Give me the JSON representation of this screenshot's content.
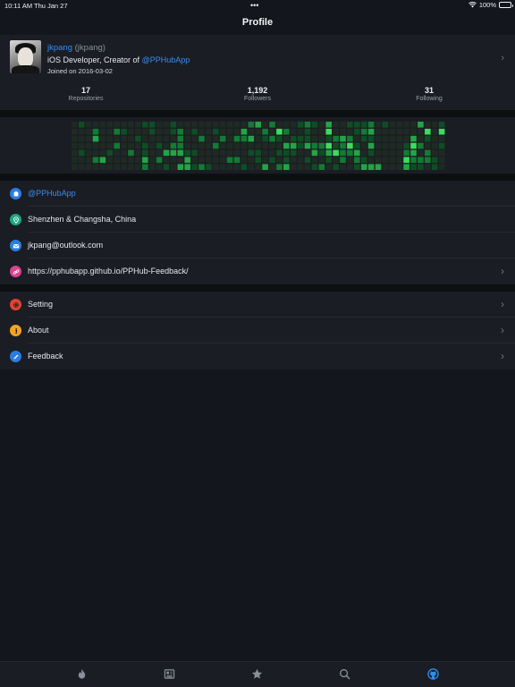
{
  "status_bar": {
    "time": "10:11 AM",
    "date": "Thu Jan 27",
    "dots": "•••",
    "battery": "100%"
  },
  "nav": {
    "title": "Profile"
  },
  "profile": {
    "login": "jkpang",
    "handle": "(jkpang)",
    "bio_prefix": "iOS Developer, Creator of ",
    "bio_link": "@PPHubApp",
    "joined": "Joined on 2016-03-02"
  },
  "stats": [
    {
      "value": "17",
      "label": "Repositories"
    },
    {
      "value": "1,192",
      "label": "Followers"
    },
    {
      "value": "31",
      "label": "Following"
    }
  ],
  "info_rows": [
    {
      "icon": "company-icon",
      "text": "@PPHubApp",
      "color": "#2a7de1"
    },
    {
      "icon": "location-icon",
      "text": "Shenzhen & Changsha, China",
      "color": "#1ba784"
    },
    {
      "icon": "email-icon",
      "text": "jkpang@outlook.com",
      "color": "#2a7de1"
    },
    {
      "icon": "link-icon",
      "text": "https://pphubapp.github.io/PPHub-Feedback/",
      "color": "#d8458d"
    }
  ],
  "menu_rows": [
    {
      "icon": "gear-icon",
      "text": "Setting",
      "color": "#e0442f"
    },
    {
      "icon": "info-icon",
      "text": "About",
      "color": "#f2a320"
    },
    {
      "icon": "pencil-icon",
      "text": "Feedback",
      "color": "#2a7de1"
    }
  ],
  "tabs": [
    {
      "icon": "flame-icon",
      "active": false
    },
    {
      "icon": "news-icon",
      "active": false
    },
    {
      "icon": "star-icon",
      "active": false
    },
    {
      "icon": "search-icon",
      "active": false
    },
    {
      "icon": "github-icon",
      "active": true
    }
  ],
  "colors": {
    "accent": "#3a8df0",
    "contrib_levels": [
      "#1f2a23",
      "#0f4d24",
      "#137b33",
      "#23a546",
      "#3ddc5e"
    ]
  }
}
